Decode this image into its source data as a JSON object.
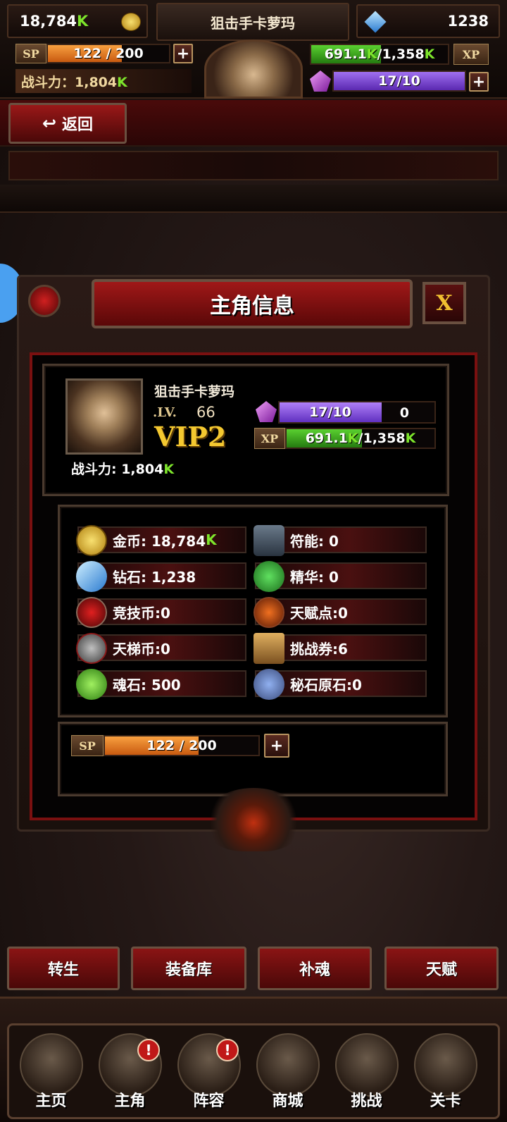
{
  "hud": {
    "gold": "18,784",
    "gold_suffix": "K",
    "player_name": "狙击手卡萝玛",
    "diamonds": "1238",
    "sp_tag": "SP",
    "sp_text": "122 / 200",
    "sp_fraction": 0.61,
    "plus": "+",
    "xp_value": "691.1",
    "xp_suffix1": "K",
    "xp_max": "/1,358",
    "xp_suffix2": "K",
    "xp_tag": "XP",
    "xp_fraction": 0.51,
    "power_label": "战斗力：1,804",
    "power_suffix": "K",
    "gem_text": "17/10"
  },
  "back_label": "返回",
  "panel": {
    "title": "主角信息",
    "close": "X",
    "hero_name": "狙击手卡萝玛",
    "lv_label": ".LV.",
    "level": "66",
    "vip": "VIP2",
    "power": "战斗力: 1,804",
    "power_suffix": "K",
    "gem_text": "17/10",
    "gem_extra": "0",
    "gem_fraction": 0.66,
    "xp_tag": "XP",
    "xp_value": "691.1",
    "xp_suffix1": "K",
    "xp_max": "/1,358",
    "xp_suffix2": "K",
    "xp_fraction": 0.51,
    "resources_left": [
      {
        "label": "金币: 18,784",
        "suffix": "K",
        "icon": "gold-coin-icon"
      },
      {
        "label": "钻石: 1,238",
        "suffix": "",
        "icon": "diamond-icon"
      },
      {
        "label": "竞技币:0",
        "suffix": "",
        "icon": "arena-coin-icon"
      },
      {
        "label": "天梯币:0",
        "suffix": "",
        "icon": "ladder-coin-icon"
      },
      {
        "label": "魂石: 500",
        "suffix": "",
        "icon": "soul-stone-icon"
      }
    ],
    "resources_right": [
      {
        "label": "符能: 0",
        "icon": "rune-icon"
      },
      {
        "label": "精华: 0",
        "icon": "essence-icon"
      },
      {
        "label": "天赋点:0",
        "icon": "talent-point-icon"
      },
      {
        "label": "挑战券:6",
        "icon": "challenge-ticket-icon"
      },
      {
        "label": "秘石原石:0",
        "icon": "mystic-ore-icon"
      }
    ],
    "sp_tag": "SP",
    "sp_text": "122 / 200",
    "sp_fraction": 0.61,
    "plus": "+"
  },
  "action_buttons": [
    "转生",
    "装备库",
    "补魂",
    "天赋"
  ],
  "nav": [
    {
      "label": "主页",
      "alert": ""
    },
    {
      "label": "主角",
      "alert": "!"
    },
    {
      "label": "阵容",
      "alert": "!"
    },
    {
      "label": "商城",
      "alert": ""
    },
    {
      "label": "挑战",
      "alert": ""
    },
    {
      "label": "关卡",
      "alert": ""
    }
  ]
}
